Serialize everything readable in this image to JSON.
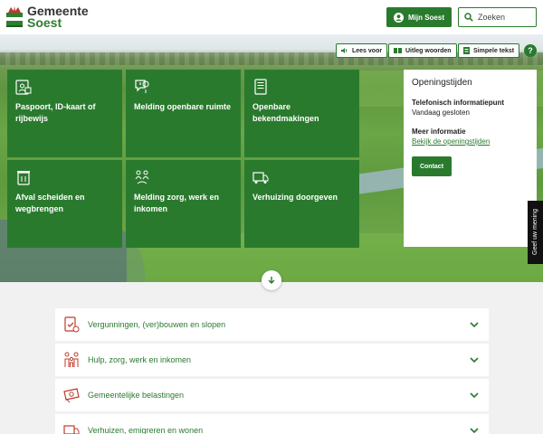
{
  "header": {
    "logo_line1": "Gemeente",
    "logo_line2": "Soest",
    "account_button": "Mijn Soest",
    "search_placeholder": "Zoeken"
  },
  "read_tools": {
    "read_aloud": "Lees voor",
    "explain_words": "Uitleg woorden",
    "simple_text": "Simpele tekst",
    "help": "?"
  },
  "tiles": [
    {
      "label": "Paspoort, ID-kaart of rijbewijs",
      "icon": "id-card-icon"
    },
    {
      "label": "Melding openbare ruimte",
      "icon": "report-location-icon"
    },
    {
      "label": "Openbare bekendmakingen",
      "icon": "announcement-document-icon"
    },
    {
      "label": "Afval scheiden en wegbrengen",
      "icon": "waste-bin-icon"
    },
    {
      "label": "Melding zorg, werk en inkomen",
      "icon": "people-care-icon"
    },
    {
      "label": "Verhuizing doorgeven",
      "icon": "moving-truck-icon"
    }
  ],
  "opening_hours": {
    "title": "Openingstijden",
    "phone_heading": "Telefonisch informatiepunt",
    "phone_status": "Vandaag gesloten",
    "more_heading": "Meer informatie",
    "more_link": "Bekijk de openingstijden",
    "contact_button": "Contact"
  },
  "feedback_tab": "Geef uw mening",
  "accordion": [
    {
      "label": "Vergunningen, (ver)bouwen en slopen",
      "icon": "permit-document-icon"
    },
    {
      "label": "Hulp, zorg, werk en inkomen",
      "icon": "family-icon"
    },
    {
      "label": "Gemeentelijke belastingen",
      "icon": "tax-money-icon"
    },
    {
      "label": "Verhuizen, emigreren en wonen",
      "icon": "moving-truck-icon"
    }
  ],
  "colors": {
    "brand_green": "#2a7a2e",
    "accent_red": "#c0392b"
  }
}
